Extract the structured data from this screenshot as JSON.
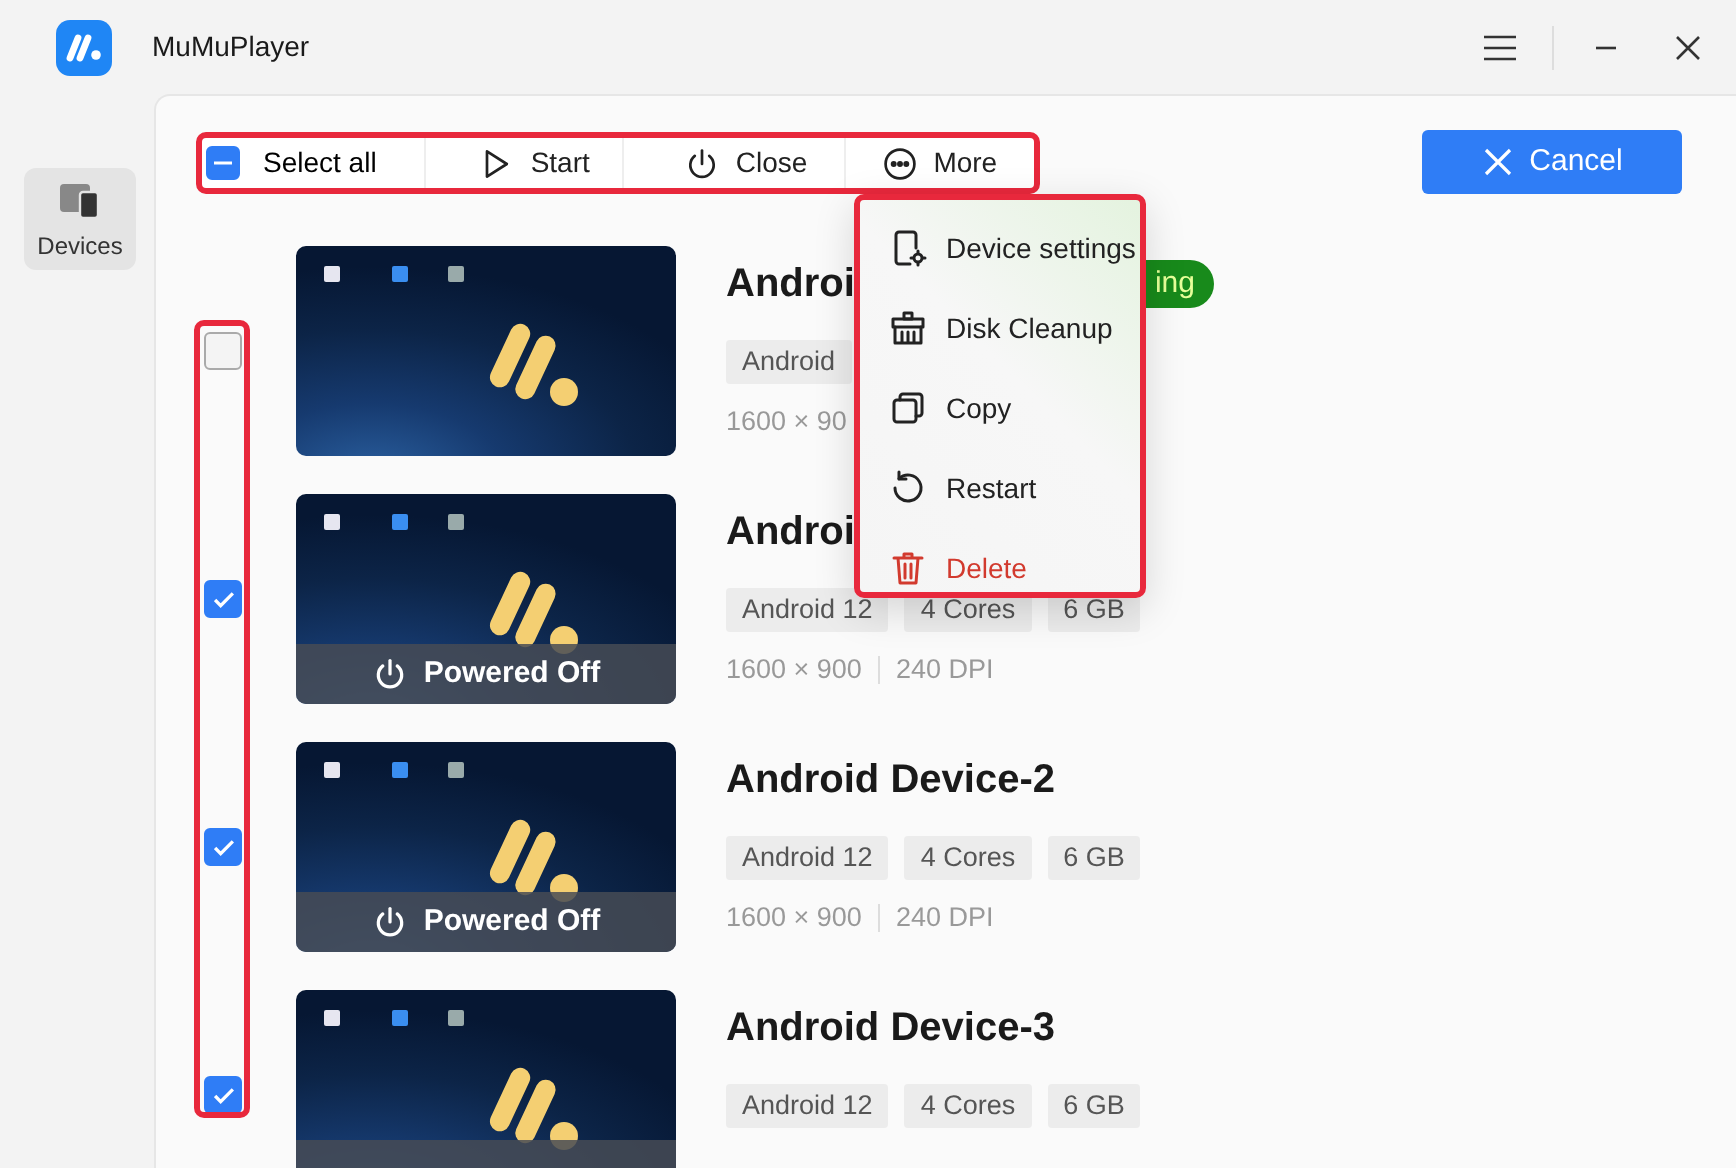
{
  "window": {
    "title": "MuMuPlayer"
  },
  "sidebar": {
    "items": [
      {
        "label": "Devices",
        "selected": true
      }
    ]
  },
  "toolbar": {
    "select_all": {
      "label": "Select all",
      "indeterminate": true
    },
    "actions": [
      {
        "kind": "start",
        "label": "Start"
      },
      {
        "kind": "close",
        "label": "Close"
      },
      {
        "kind": "more",
        "label": "More"
      }
    ],
    "cancel": {
      "label": "Cancel"
    }
  },
  "more_menu": {
    "items": [
      {
        "kind": "settings",
        "label": "Device settings",
        "danger": false
      },
      {
        "kind": "cleanup",
        "label": "Disk Cleanup",
        "danger": false
      },
      {
        "kind": "copy",
        "label": "Copy",
        "danger": false
      },
      {
        "kind": "restart",
        "label": "Restart",
        "danger": false
      },
      {
        "kind": "delete",
        "label": "Delete",
        "danger": true
      }
    ]
  },
  "devices": [
    {
      "title": "Androi",
      "checked": false,
      "status": {
        "kind": "running",
        "label": "ing"
      },
      "tags": [
        "Android"
      ],
      "specs": [
        "1600 × 90"
      ]
    },
    {
      "title": "Androi",
      "checked": true,
      "status": {
        "kind": "off",
        "label": "Powered Off"
      },
      "tags": [
        "Android 12",
        "4 Cores",
        "6 GB"
      ],
      "specs": [
        "1600 × 900",
        "240 DPI"
      ]
    },
    {
      "title": "Android Device-2",
      "checked": true,
      "status": {
        "kind": "off",
        "label": "Powered Off"
      },
      "tags": [
        "Android 12",
        "4 Cores",
        "6 GB"
      ],
      "specs": [
        "1600 × 900",
        "240 DPI"
      ]
    },
    {
      "title": "Android Device-3",
      "checked": true,
      "status": {
        "kind": "off"
      },
      "tags": [
        "Android 12",
        "4 Cores",
        "6 GB"
      ]
    }
  ]
}
